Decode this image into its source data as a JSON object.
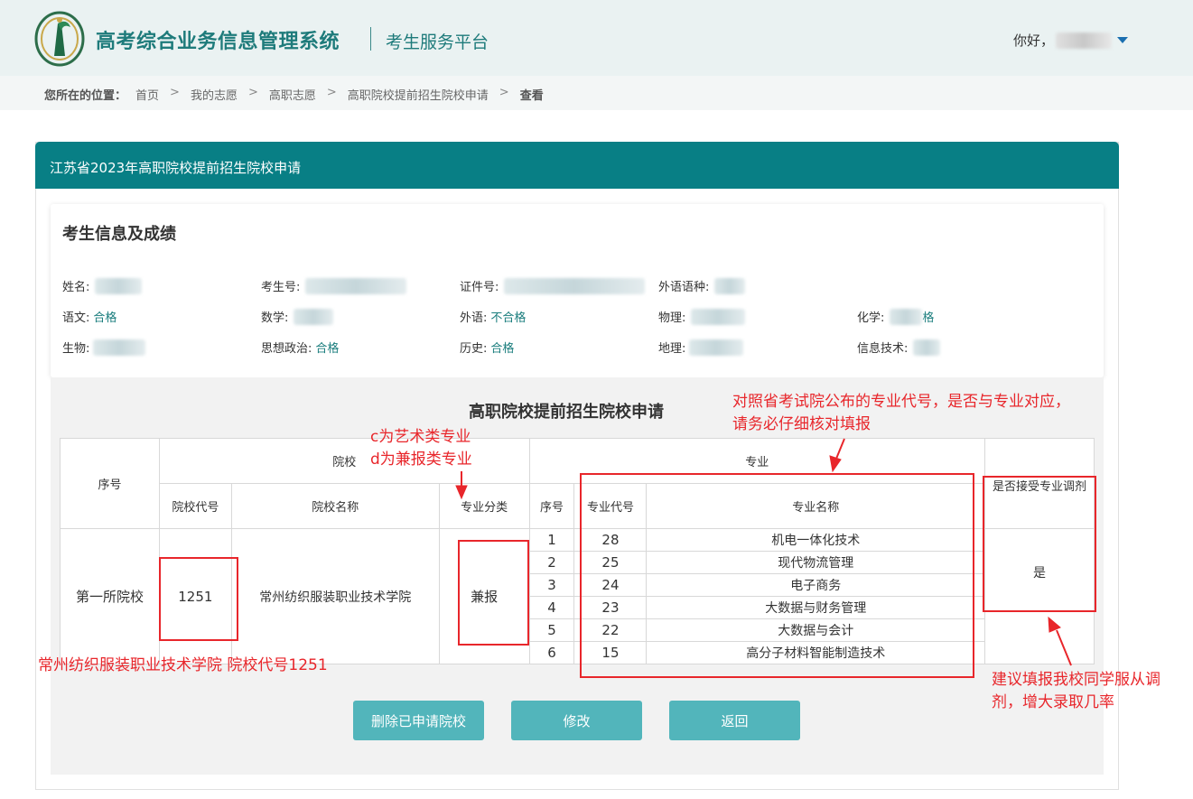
{
  "header": {
    "system_title": "高考综合业务信息管理系统",
    "platform_title": "考生服务平台",
    "greeting": "你好，"
  },
  "breadcrumb": {
    "label": "您所在的位置：",
    "items": [
      "首页",
      "我的志愿",
      "高职志愿",
      "高职院校提前招生院校申请"
    ],
    "current": "查看"
  },
  "panel": {
    "title": "江苏省2023年高职院校提前招生院校申请"
  },
  "student_info": {
    "title": "考生信息及成绩",
    "fields": {
      "name_label": "姓名:",
      "exam_no_label": "考生号:",
      "id_label": "证件号:",
      "foreign_lang_type_label": "外语语种:",
      "chinese_label": "语文:",
      "chinese_value": "合格",
      "math_label": "数学:",
      "foreign_label": "外语:",
      "foreign_value": "不合格",
      "physics_label": "物理:",
      "chemistry_label": "化学:",
      "chemistry_value_partial": "格",
      "biology_label": "生物:",
      "politics_label": "思想政治:",
      "politics_value": "合格",
      "history_label": "历史:",
      "history_value": "合格",
      "geography_label": "地理:",
      "it_label": "信息技术:"
    }
  },
  "application_table": {
    "title": "高职院校提前招生院校申请",
    "headers": {
      "seq": "序号",
      "school_group": "院校",
      "school_code": "院校代号",
      "school_name": "院校名称",
      "major_category": "专业分类",
      "major_group": "专业",
      "major_seq": "序号",
      "major_code": "专业代号",
      "major_name": "专业名称",
      "accept_adjust": "是否接受专业调剂"
    },
    "row": {
      "seq": "第一所院校",
      "school_code": "1251",
      "school_name": "常州纺织服装职业技术学院",
      "major_category": "兼报",
      "accept_adjust": "是",
      "majors": [
        {
          "seq": "1",
          "code": "28",
          "name": "机电一体化技术"
        },
        {
          "seq": "2",
          "code": "25",
          "name": "现代物流管理"
        },
        {
          "seq": "3",
          "code": "24",
          "name": "电子商务"
        },
        {
          "seq": "4",
          "code": "23",
          "name": "大数据与财务管理"
        },
        {
          "seq": "5",
          "code": "22",
          "name": "大数据与会计"
        },
        {
          "seq": "6",
          "code": "15",
          "name": "高分子材料智能制造技术"
        }
      ]
    }
  },
  "buttons": {
    "delete": "删除已申请院校",
    "modify": "修改",
    "back": "返回"
  },
  "annotations": {
    "category_note_1": "c为艺术类专业",
    "category_note_2": "d为兼报类专业",
    "code_check_1": "对照省考试院公布的专业代号，是否与专业对应，",
    "code_check_2": "请务必仔细核对填报",
    "school_note": "常州纺织服装职业技术学院 院校代号1251",
    "adjust_note_1": "建议填报我校同学服从调",
    "adjust_note_2": "剂，增大录取几率",
    "color": "#e8262b"
  },
  "colors": {
    "brand_teal": "#087f85",
    "button": "#52b5bb",
    "title_teal": "#1e7b7b"
  }
}
